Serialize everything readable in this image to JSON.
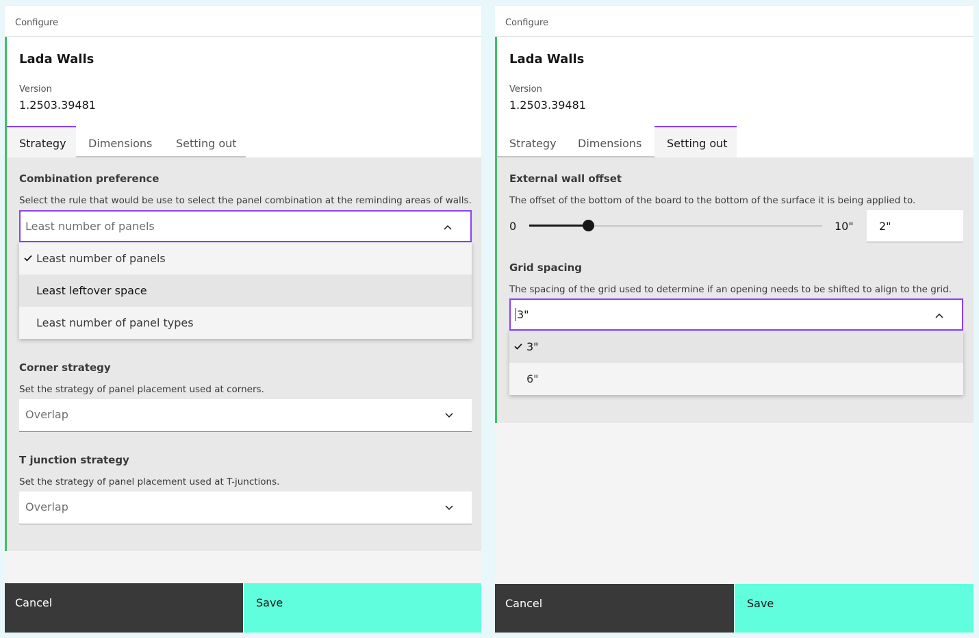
{
  "left": {
    "breadcrumb": "Configure",
    "title": "Lada Walls",
    "version_label": "Version",
    "version_value": "1.2503.39481",
    "tabs": [
      {
        "label": "Strategy",
        "active": true
      },
      {
        "label": "Dimensions",
        "active": false
      },
      {
        "label": "Setting out",
        "active": false
      }
    ],
    "combination": {
      "title": "Combination preference",
      "description": "Select the rule that would be use to select the panel combination at the reminding areas of walls.",
      "selected": "Least number of panels",
      "options": [
        "Least number of panels",
        "Least leftover space",
        "Least number of panel types"
      ]
    },
    "corner": {
      "title": "Corner strategy",
      "description": "Set the strategy of panel placement used at corners.",
      "selected": "Overlap"
    },
    "tjunction": {
      "title": "T junction strategy",
      "description": "Set the strategy of panel placement used at T-junctions.",
      "selected": "Overlap"
    },
    "cancel_label": "Cancel",
    "save_label": "Save"
  },
  "right": {
    "breadcrumb": "Configure",
    "title": "Lada Walls",
    "version_label": "Version",
    "version_value": "1.2503.39481",
    "tabs": [
      {
        "label": "Strategy",
        "active": false
      },
      {
        "label": "Dimensions",
        "active": false
      },
      {
        "label": "Setting out",
        "active": true
      }
    ],
    "offset": {
      "title": "External wall offset",
      "description": "The offset of the bottom of the board to the bottom of the surface it is being applied to.",
      "min_label": "0",
      "max_label": "10\"",
      "value": "2\"",
      "fraction": 0.2
    },
    "grid": {
      "title": "Grid spacing",
      "description": "The spacing of the grid used to determine if an opening needs to be shifted to align to the grid.",
      "input_value": "3\"",
      "options": [
        "3\"",
        "6\""
      ]
    },
    "cancel_label": "Cancel",
    "save_label": "Save"
  },
  "colors": {
    "accent": "#8a3ffc",
    "left_border": "#42be65",
    "save_button": "#61fede",
    "cancel_button": "#393939"
  },
  "icons": {
    "chevron_up": "chevron-up-icon",
    "chevron_down": "chevron-down-icon",
    "check": "checkmark-icon"
  }
}
